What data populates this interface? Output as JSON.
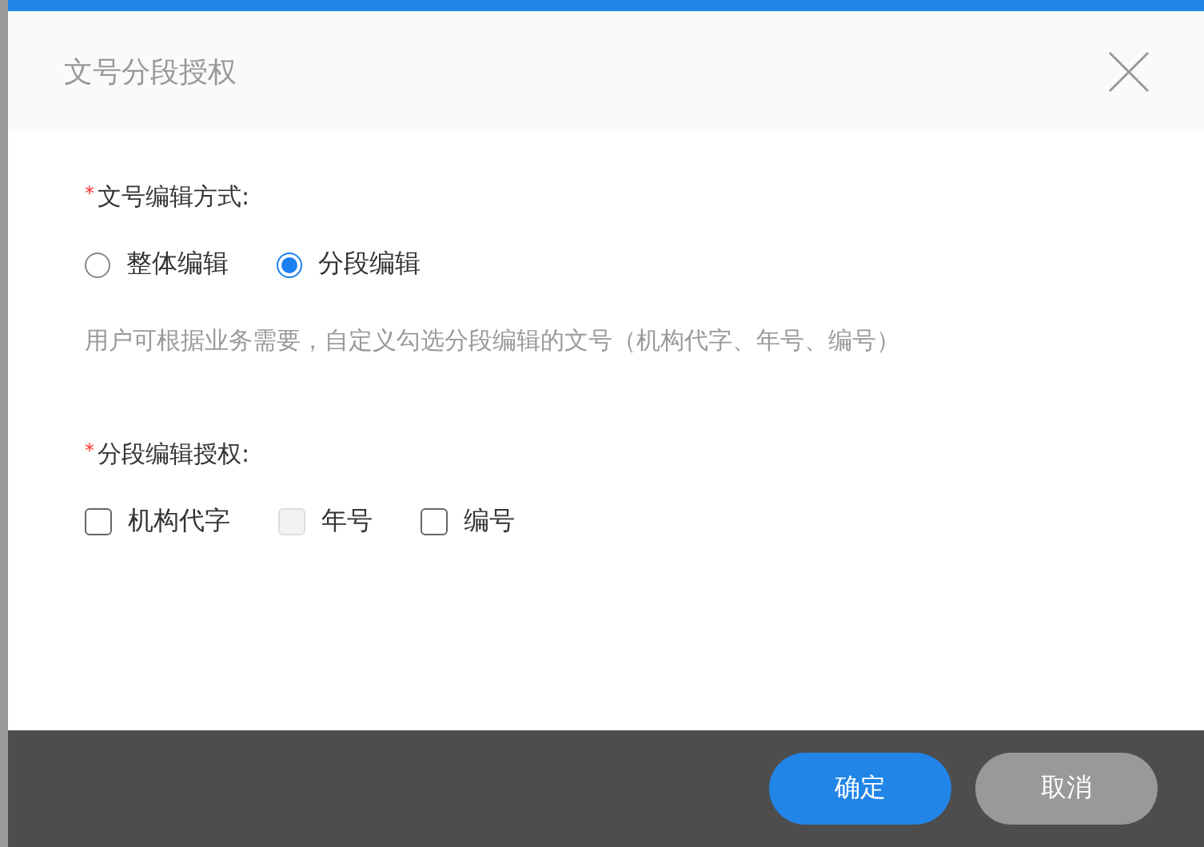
{
  "dialog": {
    "title": "文号分段授权"
  },
  "edit_mode": {
    "required_mark": "*",
    "label": "文号编辑方式:",
    "options": [
      {
        "label": "整体编辑",
        "selected": false
      },
      {
        "label": "分段编辑",
        "selected": true
      }
    ],
    "hint": "用户可根据业务需要，自定义勾选分段编辑的文号（机构代字、年号、编号）"
  },
  "segments": {
    "required_mark": "*",
    "label": "分段编辑授权:",
    "options": [
      {
        "label": "机构代字",
        "checked": false,
        "disabled": false
      },
      {
        "label": "年号",
        "checked": false,
        "disabled": true
      },
      {
        "label": "编号",
        "checked": false,
        "disabled": false
      }
    ]
  },
  "buttons": [
    {
      "label": "确定",
      "kind": "primary"
    },
    {
      "label": "取消",
      "kind": "secondary"
    }
  ]
}
